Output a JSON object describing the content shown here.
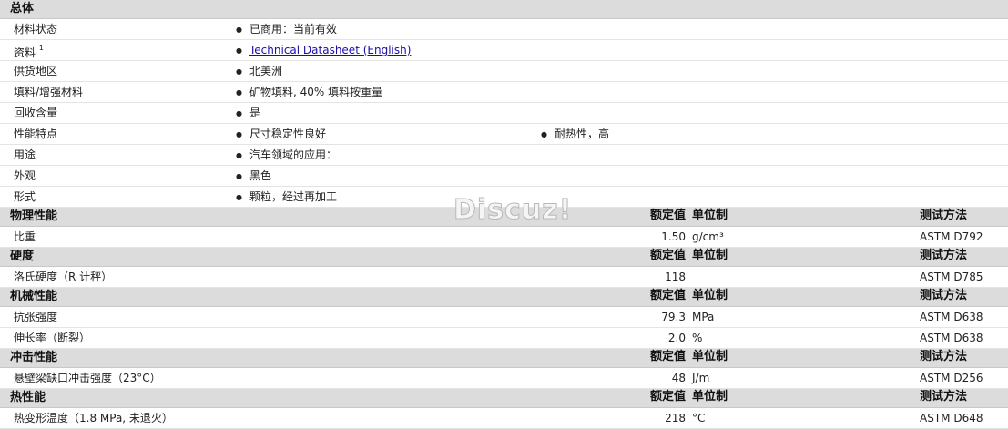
{
  "overall": {
    "title": "总体",
    "rows": [
      {
        "label": "材料状态",
        "values": [
          "已商用：当前有效"
        ]
      },
      {
        "label": "资料",
        "sup": "1",
        "link": "Technical Datasheet (English)"
      },
      {
        "label": "供货地区",
        "values": [
          "北美洲"
        ]
      },
      {
        "label": "填料/增强材料",
        "values": [
          "矿物填料, 40% 填料按重量"
        ]
      },
      {
        "label": "回收含量",
        "values": [
          "是"
        ]
      },
      {
        "label": "性能特点",
        "values": [
          "尺寸稳定性良好",
          "耐热性，高"
        ]
      },
      {
        "label": "用途",
        "values": [
          "汽车领域的应用："
        ]
      },
      {
        "label": "外观",
        "values": [
          "黑色"
        ]
      },
      {
        "label": "形式",
        "values": [
          "颗粒，经过再加工"
        ]
      }
    ]
  },
  "column_headers": {
    "value": "额定值",
    "unit": "单位制",
    "method": "测试方法"
  },
  "sections": [
    {
      "title": "物理性能",
      "rows": [
        {
          "name": "比重",
          "value": "1.50",
          "unit": "g/cm³",
          "method": "ASTM D792"
        }
      ]
    },
    {
      "title": "硬度",
      "rows": [
        {
          "name": "洛氏硬度（R 计秤）",
          "value": "118",
          "unit": "",
          "method": "ASTM D785"
        }
      ]
    },
    {
      "title": "机械性能",
      "rows": [
        {
          "name": "抗张强度",
          "value": "79.3",
          "unit": "MPa",
          "method": "ASTM D638"
        },
        {
          "name": "伸长率（断裂）",
          "value": "2.0",
          "unit": "%",
          "method": "ASTM D638"
        }
      ]
    },
    {
      "title": "冲击性能",
      "rows": [
        {
          "name": "悬壁梁缺口冲击强度（23°C）",
          "value": "48",
          "unit": "J/m",
          "method": "ASTM D256"
        }
      ]
    },
    {
      "title": "热性能",
      "rows": [
        {
          "name": "热变形温度（1.8 MPa, 未退火）",
          "value": "218",
          "unit": "°C",
          "method": "ASTM D648"
        }
      ]
    }
  ],
  "watermark": "Discuz!"
}
